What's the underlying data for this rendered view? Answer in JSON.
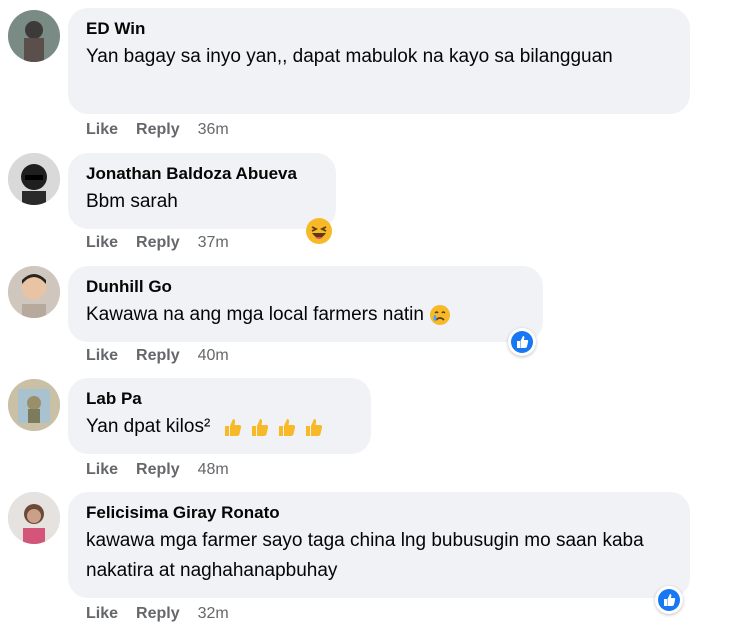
{
  "comments": [
    {
      "name": "ED Win",
      "text": "Yan bagay sa inyo yan,, dapat mabulok na kayo sa bilangguan",
      "like": "Like",
      "reply": "Reply",
      "time": "36m",
      "avatar_icon": "avatar-photo-icon"
    },
    {
      "name": "Jonathan Baldoza Abueva",
      "text": "Bbm sarah",
      "like": "Like",
      "reply": "Reply",
      "time": "37m",
      "reaction": "haha-reaction-icon"
    },
    {
      "name": "Dunhill Go",
      "text": "Kawawa na ang mga local farmers natin",
      "like": "Like",
      "reply": "Reply",
      "time": "40m",
      "inline_emoji": "crying-face-emoji",
      "reaction": "like-reaction-icon"
    },
    {
      "name": "Lab Pa",
      "text": "Yan dpat kilos²",
      "like": "Like",
      "reply": "Reply",
      "time": "48m",
      "inline_emoji": "thumbs-up-emoji x4"
    },
    {
      "name": "Felicisima Giray Ronato",
      "text": "kawawa mga farmer sayo taga china lng bubusugin mo saan kaba nakatira at naghahanapbuhay",
      "like": "Like",
      "reply": "Reply",
      "time": "32m",
      "reaction": "like-reaction-icon"
    }
  ],
  "colors": {
    "bubble": "#f0f2f5",
    "meta_text": "#65676b",
    "like_blue": "#1877f2",
    "haha_yellow": "#f7b928"
  }
}
